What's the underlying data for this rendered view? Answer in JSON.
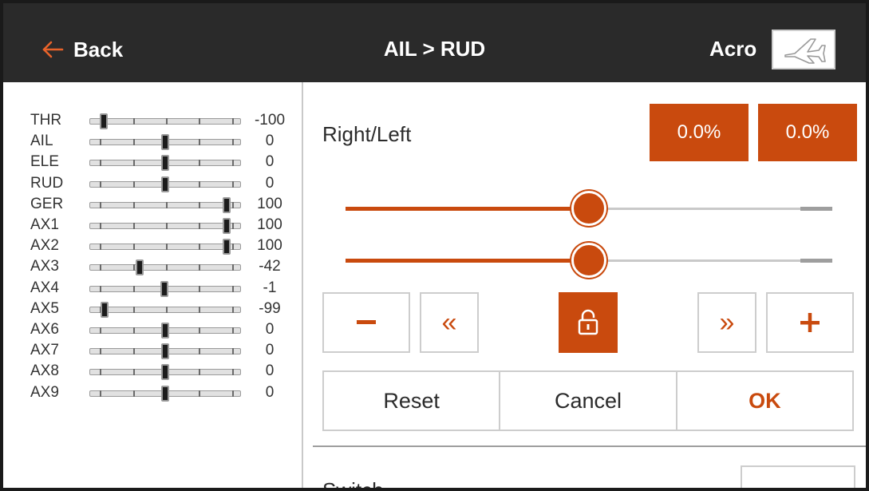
{
  "header": {
    "back_label": "Back",
    "title": "AIL > RUD",
    "model_name": "Acro",
    "model_icon": "airplane-icon"
  },
  "monitor": {
    "channels": [
      {
        "name": "THR",
        "value": "-100",
        "level": -100
      },
      {
        "name": "AIL",
        "value": "0",
        "level": 0
      },
      {
        "name": "ELE",
        "value": "0",
        "level": 0
      },
      {
        "name": "RUD",
        "value": "0",
        "level": 0
      },
      {
        "name": "GER",
        "value": "100",
        "level": 100
      },
      {
        "name": "AX1",
        "value": "100",
        "level": 100
      },
      {
        "name": "AX2",
        "value": "100",
        "level": 100
      },
      {
        "name": "AX3",
        "value": "-42",
        "level": -42
      },
      {
        "name": "AX4",
        "value": "-1",
        "level": -1
      },
      {
        "name": "AX5",
        "value": "-99",
        "level": -99
      },
      {
        "name": "AX6",
        "value": "0",
        "level": 0
      },
      {
        "name": "AX7",
        "value": "0",
        "level": 0
      },
      {
        "name": "AX8",
        "value": "0",
        "level": 0
      },
      {
        "name": "AX9",
        "value": "0",
        "level": 0
      }
    ]
  },
  "mix": {
    "label": "Right/Left",
    "right_value": "0.0%",
    "left_value": "0.0%",
    "slider_right_position": 0.5,
    "slider_left_position": 0.5
  },
  "controls": {
    "minus_icon": "minus-icon",
    "coarse_down_icon": "double-chevron-left-icon",
    "lock_icon": "unlock-icon",
    "coarse_up_icon": "double-chevron-right-icon",
    "plus_icon": "plus-icon"
  },
  "actions": {
    "reset_label": "Reset",
    "cancel_label": "Cancel",
    "ok_label": "OK"
  },
  "switch": {
    "label": "Switch"
  },
  "colors": {
    "accent": "#c94a0e",
    "header_bg": "#2a2a2a"
  }
}
